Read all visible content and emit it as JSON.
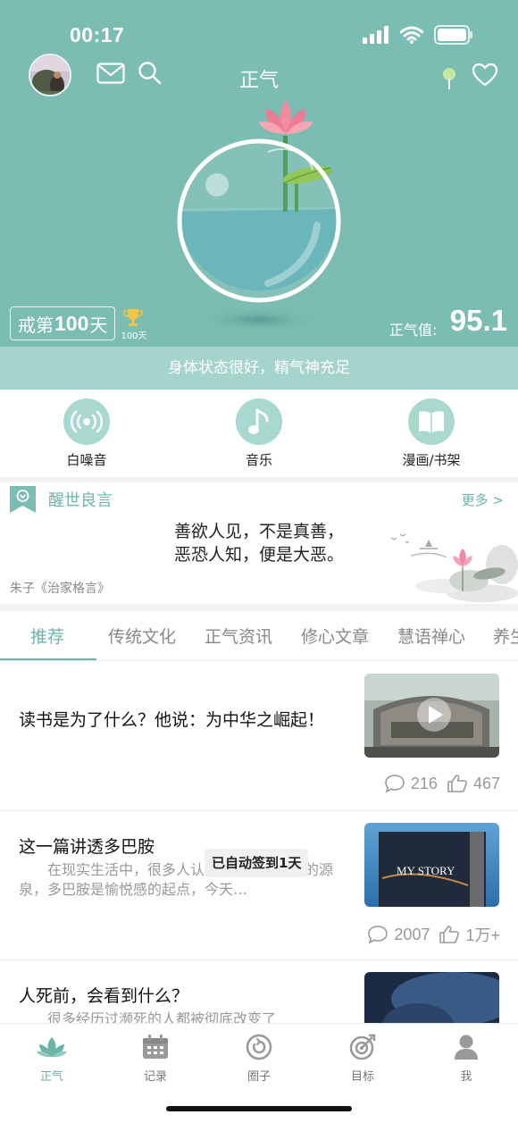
{
  "status_bar": {
    "time": "00:17"
  },
  "header": {
    "title": "正气"
  },
  "streak": {
    "prefix": "戒第",
    "days": "100",
    "suffix": "天",
    "trophy_label": "100天"
  },
  "score": {
    "label": "正气值:",
    "value": "95.1"
  },
  "status_message": "身体状态很好，精气神充足",
  "quick_actions": [
    {
      "label": "白噪音",
      "icon": "broadcast-icon"
    },
    {
      "label": "音乐",
      "icon": "music-note-icon"
    },
    {
      "label": "漫画/书架",
      "icon": "book-icon"
    }
  ],
  "quote": {
    "title": "醒世良言",
    "more": "更多 >",
    "line1": "善欲人见，不是真善，",
    "line2": "恶恐人知，便是大恶。",
    "source": "朱子《治家格言》"
  },
  "tabs": [
    "推荐",
    "传统文化",
    "正气资讯",
    "修心文章",
    "慧语禅心",
    "养生"
  ],
  "active_tab": "推荐",
  "articles": [
    {
      "title": "读书是为了什么？他说：为中华之崛起！",
      "summary": "",
      "comments": "216",
      "likes": "467",
      "thumb_text": ""
    },
    {
      "title": "这一篇讲透多巴胺",
      "summary": "在现实生活中，很多人认为多巴胺是快乐的源泉，多巴胺是愉悦感的起点，今天…",
      "comments": "2007",
      "likes": "1万+",
      "thumb_text": "MY STORY"
    },
    {
      "title": "人死前，会看到什么？",
      "summary": "很多经历过濒死的人都被彻底改变了",
      "comments": "",
      "likes": "",
      "thumb_text": ""
    }
  ],
  "toast": "已自动签到1天",
  "tabbar": [
    {
      "label": "正气",
      "icon": "lotus-icon",
      "active": true
    },
    {
      "label": "记录",
      "icon": "calendar-icon",
      "active": false
    },
    {
      "label": "圈子",
      "icon": "circle-refresh-icon",
      "active": false
    },
    {
      "label": "目标",
      "icon": "target-icon",
      "active": false
    },
    {
      "label": "我",
      "icon": "person-icon",
      "active": false
    }
  ],
  "colors": {
    "accent": "#6bb5a8",
    "hero_bg": "#7bbcb3",
    "strip_bg": "#a5d4cc",
    "icon_circle": "#a9d8cf"
  }
}
